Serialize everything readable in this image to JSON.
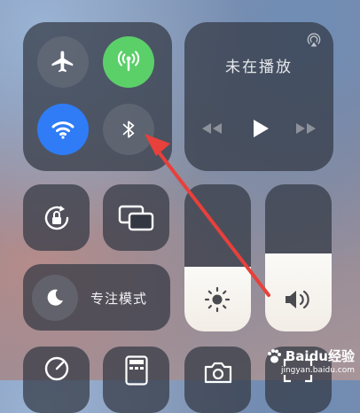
{
  "now_playing": {
    "title": "未在播放"
  },
  "focus": {
    "label": "专注模式"
  },
  "watermark": {
    "brand": "Baidu经验",
    "url": "jingyan.baidu.com"
  },
  "colors": {
    "cellular_active": "#5bd069",
    "wifi_active": "#2f7cf6",
    "arrow": "#e8403b"
  },
  "icons": {
    "airplane": "airplane-icon",
    "cellular": "cellular-antenna-icon",
    "wifi": "wifi-icon",
    "bluetooth": "bluetooth-icon",
    "airplay": "airplay-icon",
    "rotation_lock": "rotation-lock-icon",
    "mirroring": "screen-mirroring-icon",
    "moon": "moon-icon",
    "brightness": "sun-icon",
    "volume": "speaker-icon"
  }
}
